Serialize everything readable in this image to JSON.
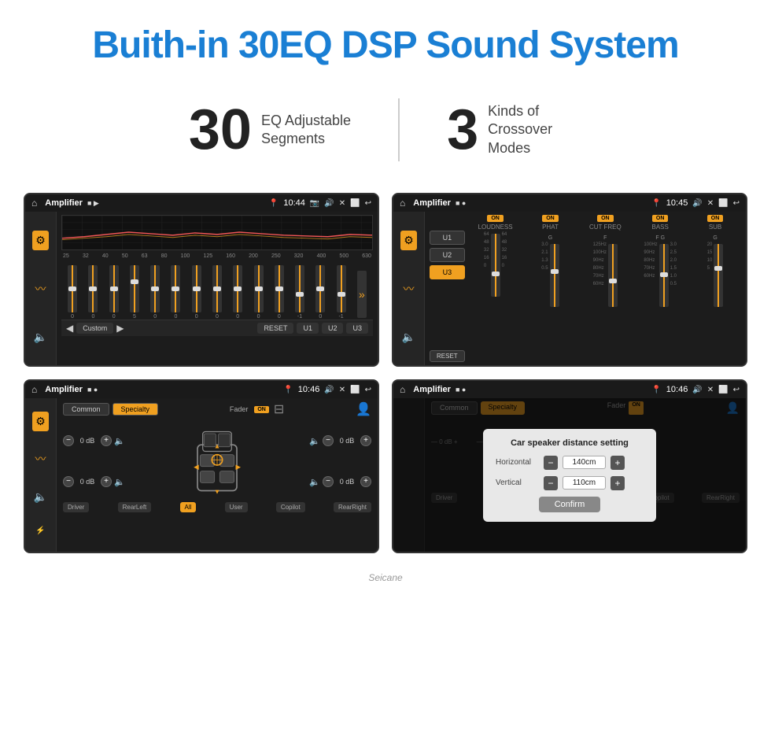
{
  "header": {
    "title": "Buith-in 30EQ DSP Sound System"
  },
  "stats": [
    {
      "number": "30",
      "label": "EQ Adjustable\nSegments"
    },
    {
      "number": "3",
      "label": "Kinds of\nCrossover Modes"
    }
  ],
  "screens": [
    {
      "id": "screen1",
      "status_bar": {
        "app": "Amplifier",
        "time": "10:44",
        "icons": [
          "📷",
          "🔊",
          "✕",
          "⬜",
          "↩"
        ]
      },
      "type": "eq",
      "freqs": [
        "25",
        "32",
        "40",
        "50",
        "63",
        "80",
        "100",
        "125",
        "160",
        "200",
        "250",
        "320",
        "400",
        "500",
        "630"
      ],
      "values": [
        "0",
        "0",
        "0",
        "5",
        "0",
        "0",
        "0",
        "0",
        "0",
        "0",
        "0",
        "-1",
        "0",
        "-1"
      ],
      "bottom_btns": [
        "Custom",
        "RESET",
        "U1",
        "U2",
        "U3"
      ]
    },
    {
      "id": "screen2",
      "status_bar": {
        "app": "Amplifier",
        "time": "10:45"
      },
      "type": "crossover",
      "u_presets": [
        "U1",
        "U2",
        "U3"
      ],
      "active_preset": "U3",
      "channels": [
        {
          "label": "LOUDNESS",
          "on": true
        },
        {
          "label": "PHAT",
          "on": true
        },
        {
          "label": "CUT FREQ",
          "on": true
        },
        {
          "label": "BASS",
          "on": true
        },
        {
          "label": "SUB",
          "on": true
        }
      ]
    },
    {
      "id": "screen3",
      "status_bar": {
        "app": "Amplifier",
        "time": "10:46"
      },
      "type": "speaker",
      "tabs": [
        "Common",
        "Specialty"
      ],
      "active_tab": "Specialty",
      "fader_label": "Fader",
      "fader_on": true,
      "channels_left": [
        {
          "value": "0 dB"
        },
        {
          "value": "0 dB"
        }
      ],
      "channels_right": [
        {
          "value": "0 dB"
        },
        {
          "value": "0 dB"
        }
      ],
      "bottom_btns": [
        "Driver",
        "RearLeft",
        "All",
        "User",
        "Copilot",
        "RearRight"
      ],
      "active_bottom": "All"
    },
    {
      "id": "screen4",
      "status_bar": {
        "app": "Amplifier",
        "time": "10:46"
      },
      "type": "speaker-dialog",
      "dialog": {
        "title": "Car speaker distance setting",
        "rows": [
          {
            "label": "Horizontal",
            "value": "140cm"
          },
          {
            "label": "Vertical",
            "value": "110cm"
          }
        ],
        "confirm_btn": "Confirm"
      }
    }
  ],
  "watermark": "Seicane"
}
